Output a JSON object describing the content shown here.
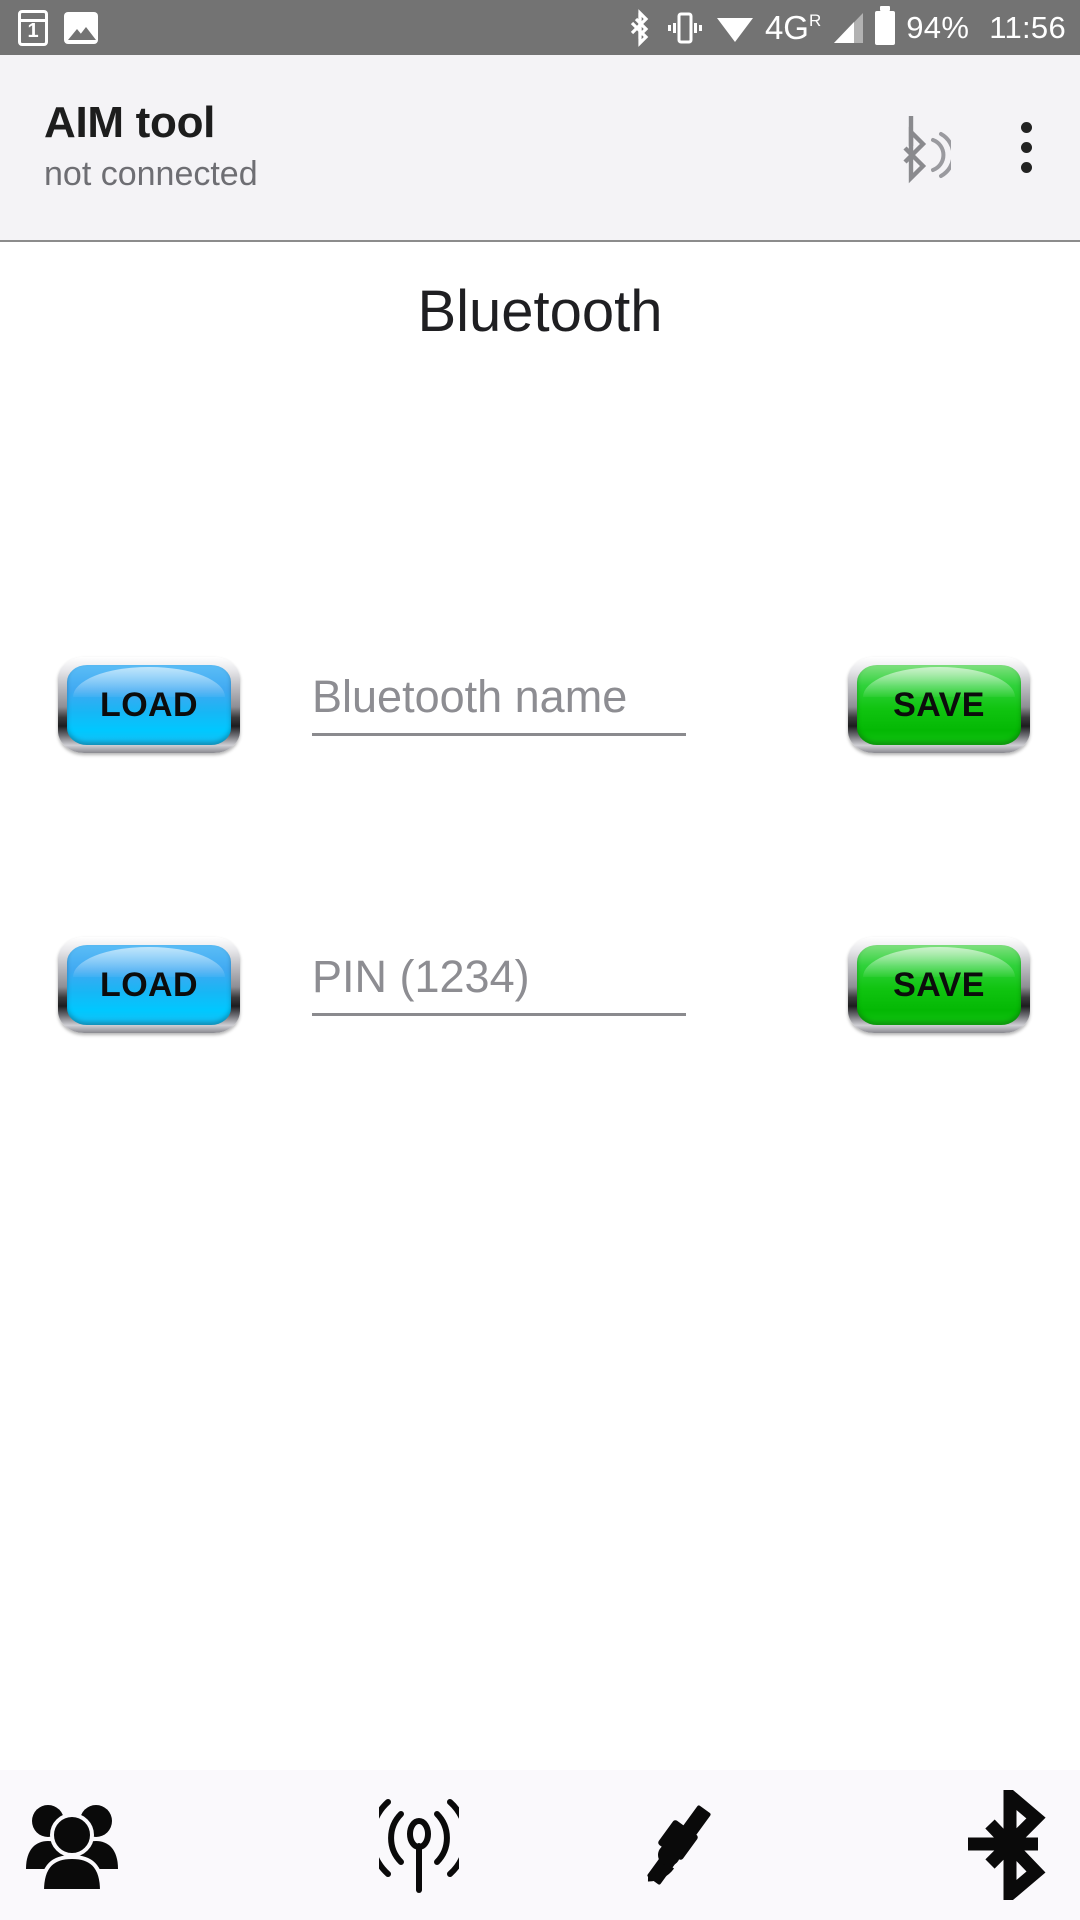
{
  "status_bar": {
    "background": "#737373",
    "notifications": [
      {
        "icon": "sim-card-icon",
        "label": "1"
      },
      {
        "icon": "gallery-image-icon"
      }
    ],
    "icons": [
      "bluetooth-icon",
      "vibrate-icon",
      "wifi-icon",
      "signal-icon"
    ],
    "network": "4G",
    "network_superscript": "R",
    "battery_percent": "94%",
    "time": "11:56"
  },
  "app_bar": {
    "title": "AIM tool",
    "subtitle": "not connected",
    "bluetooth_status_icon": "bluetooth-searching-icon",
    "overflow_icon": "overflow-menu-icon"
  },
  "page": {
    "heading": "Bluetooth",
    "background": "#faf9fc"
  },
  "rows": [
    {
      "load_label": "LOAD",
      "save_label": "SAVE",
      "input_value": "",
      "input_placeholder": "Bluetooth name"
    },
    {
      "load_label": "LOAD",
      "save_label": "SAVE",
      "input_value": "",
      "input_placeholder": "PIN (1234)"
    }
  ],
  "colors": {
    "load_button": "#18b6f5",
    "save_button": "#10c410",
    "bezel": "#bfbfc4",
    "placeholder_text": "#8d8d92",
    "divider": "#8a8a8e"
  },
  "bottom_nav": [
    {
      "icon": "group-people-icon",
      "name": "nav-group"
    },
    {
      "icon": "broadcast-antenna-icon",
      "name": "nav-antenna"
    },
    {
      "icon": "satellite-icon",
      "name": "nav-satellite"
    },
    {
      "icon": "bluetooth-icon",
      "name": "nav-bluetooth"
    }
  ]
}
